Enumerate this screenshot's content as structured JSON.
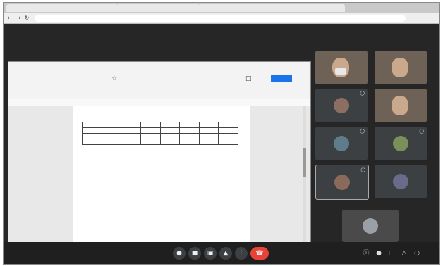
{
  "browser": {
    "tabs": [
      "",
      "",
      ""
    ],
    "url": ""
  },
  "meet": {
    "title": "",
    "time_label": ""
  },
  "doc": {
    "title": "",
    "menu": "",
    "share_label": "",
    "heading": "",
    "table_rows": [
      [
        "",
        "",
        "",
        "",
        "",
        "",
        "",
        ""
      ],
      [
        "",
        "",
        "",
        "",
        "",
        "",
        "",
        ""
      ],
      [
        "",
        "",
        "",
        "",
        "",
        "",
        "",
        ""
      ],
      [
        "",
        "",
        "",
        "",
        "",
        "",
        "",
        ""
      ]
    ],
    "paragraph": "",
    "list": ""
  },
  "participants": [
    {
      "name": "",
      "type": "video"
    },
    {
      "name": "",
      "type": "video"
    },
    {
      "name": "",
      "type": "avatar",
      "color": "#8d6e63"
    },
    {
      "name": "",
      "type": "video"
    },
    {
      "name": "",
      "type": "avatar",
      "color": "#5f7c8a"
    },
    {
      "name": "",
      "type": "avatar",
      "color": "#7b8f5a"
    },
    {
      "name": "",
      "type": "avatar",
      "color": "#8a6a5a"
    },
    {
      "name": "",
      "type": "avatar",
      "color": "#6a6a8a"
    }
  ],
  "icons": {
    "back": "arrow-left-icon",
    "forward": "arrow-right-icon",
    "reload": "reload-icon",
    "mic": "mic-icon",
    "camera": "camera-icon",
    "captions": "captions-icon",
    "present": "present-icon",
    "more": "more-icon",
    "end_call": "end-call-icon",
    "info": "info-icon",
    "people": "people-icon",
    "chat": "chat-icon",
    "activities": "activities-icon"
  },
  "colors": {
    "end_call": "#ea4335",
    "share_button": "#1a73e8"
  }
}
